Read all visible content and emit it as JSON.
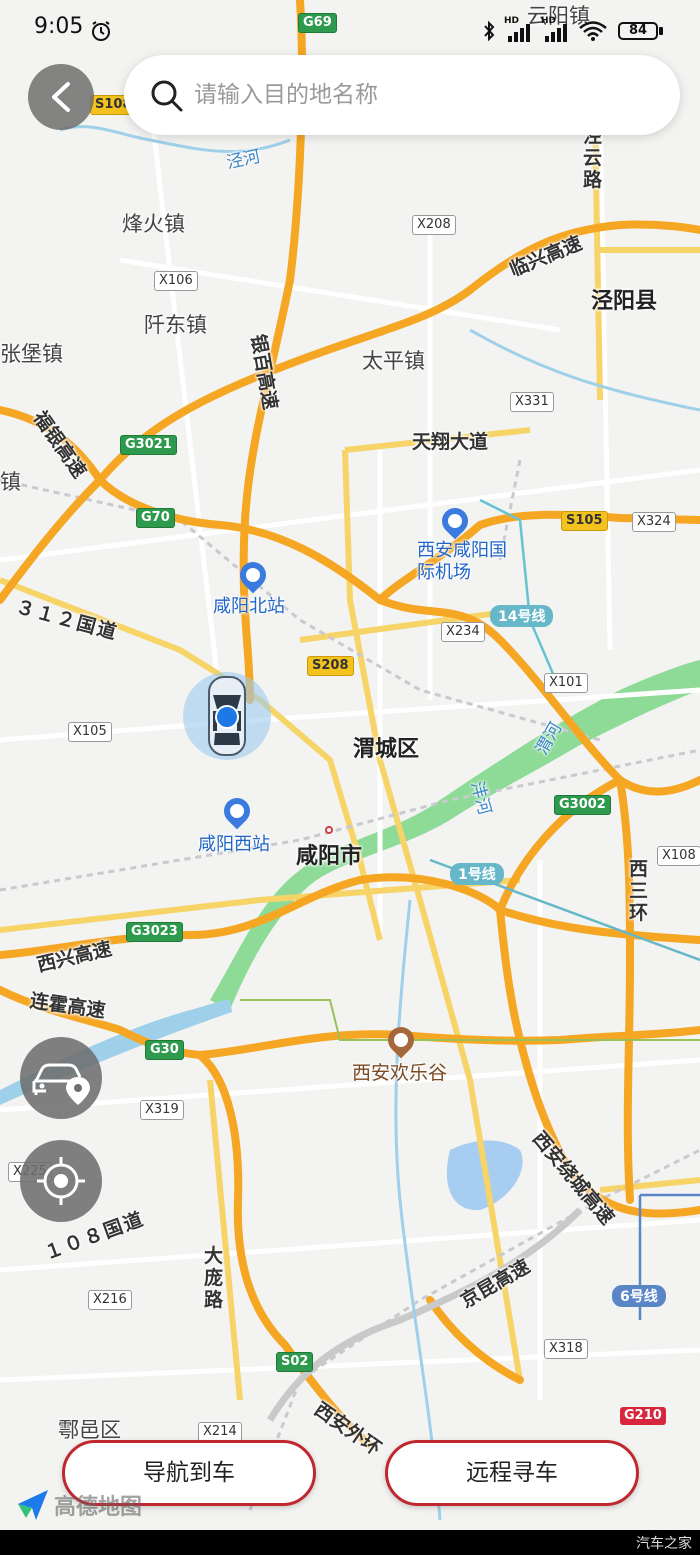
{
  "status_bar": {
    "time": "9:05",
    "battery": "84",
    "hd_label": "HD"
  },
  "search": {
    "placeholder": "请输入目的地名称"
  },
  "map": {
    "places": {
      "fenghuo": "烽火镇",
      "zhangbao": "张堡镇",
      "qiandong": "阡东镇",
      "taiping": "太平镇",
      "jingyang": "泾阳县",
      "weicheng": "渭城区",
      "xianyang": "咸阳市",
      "huyi": "鄠邑区",
      "zhen": "镇",
      "yunyang": "云阳镇"
    },
    "pois": {
      "airport": "西安咸阳国际机场",
      "north_station": "咸阳北站",
      "west_station": "咸阳西站",
      "happy_valley": "西安欢乐谷"
    },
    "water": {
      "jinghe": "泾河",
      "weihe": "渭河",
      "fenghe": "沣河"
    },
    "roads": {
      "linxing": "临兴高速",
      "yinbai": "银百高速",
      "fuyin": "福银高速",
      "tianxiang": "天翔大道",
      "g312": "３１２国道",
      "xixing": "西兴高速",
      "lianhuo": "连霍高速",
      "g108": "１０８国道",
      "dapang": "大庞路",
      "xiwai": "西安外环",
      "jingkun": "京昆高速",
      "raocheng": "西安绕城高速",
      "xisanhuan": "西三环",
      "jingyun": "泾云路"
    },
    "shields": {
      "g69": "G69",
      "s108": "S108",
      "x208": "X208",
      "x106": "X106",
      "x331": "X331",
      "g3021": "G3021",
      "g70": "G70",
      "s105": "S105",
      "x324": "X324",
      "x234": "X234",
      "s208": "S208",
      "x101": "X101",
      "x105": "X105",
      "g3002": "G3002",
      "x108": "X108",
      "g3023": "G3023",
      "g30": "G30",
      "x319": "X319",
      "x225": "X225",
      "x216": "X216",
      "s02": "S02",
      "x318": "X318",
      "x214": "X214",
      "g210": "G210"
    },
    "metro": {
      "line14": "14号线",
      "line1": "1号线",
      "line6": "6号线"
    }
  },
  "buttons": {
    "navigate_to_car": "导航到车",
    "remote_find_car": "远程寻车"
  },
  "branding": {
    "amap": "高德地图",
    "watermark": "汽车之家"
  },
  "colors": {
    "accent_red": "#c0282f",
    "highway": "#f5a623",
    "river_green": "#7bd08a",
    "fab_gray": "#6e6e6e"
  }
}
